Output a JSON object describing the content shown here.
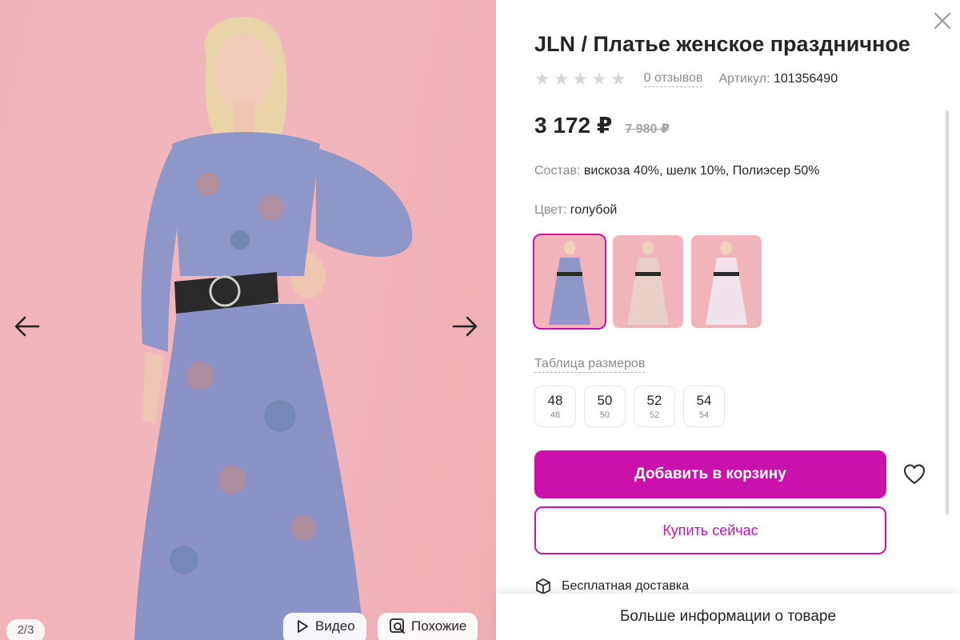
{
  "gallery": {
    "counter": "2/3",
    "video_label": "Видео",
    "similar_label": "Похожие",
    "prev_icon": "arrow-left-icon",
    "next_icon": "arrow-right-icon"
  },
  "product": {
    "title": "JLN / Платье женское праздничное",
    "rating": 0,
    "rating_max": 5,
    "reviews": "0 отзывов",
    "article_label": "Артикул:",
    "article_value": "101356490",
    "price": "3 172 ₽",
    "old_price": "7 980 ₽",
    "composition_label": "Состав:",
    "composition_value": "вискоза 40%, шелк 10%, Полиэсер 50%",
    "color_label": "Цвет:",
    "color_value": "голубой",
    "swatches": [
      {
        "name": "голубой",
        "dress": "#8f97c8",
        "selected": true
      },
      {
        "name": "бежевый",
        "dress": "#e8cfc8",
        "selected": false
      },
      {
        "name": "белый",
        "dress": "#efe2ea",
        "selected": false
      }
    ],
    "size_table_label": "Таблица размеров",
    "sizes": [
      {
        "main": "48",
        "sub": "48"
      },
      {
        "main": "50",
        "sub": "50"
      },
      {
        "main": "52",
        "sub": "52"
      },
      {
        "main": "54",
        "sub": "54"
      }
    ]
  },
  "actions": {
    "add_to_cart": "Добавить в корзину",
    "buy_now": "Купить сейчас",
    "free_delivery": "Бесплатная доставка",
    "more_info": "Больше информации о товаре"
  },
  "colors": {
    "accent": "#cb11ab",
    "background_pink": "#f1b7bd",
    "dress_blue": "#8f97c8"
  }
}
